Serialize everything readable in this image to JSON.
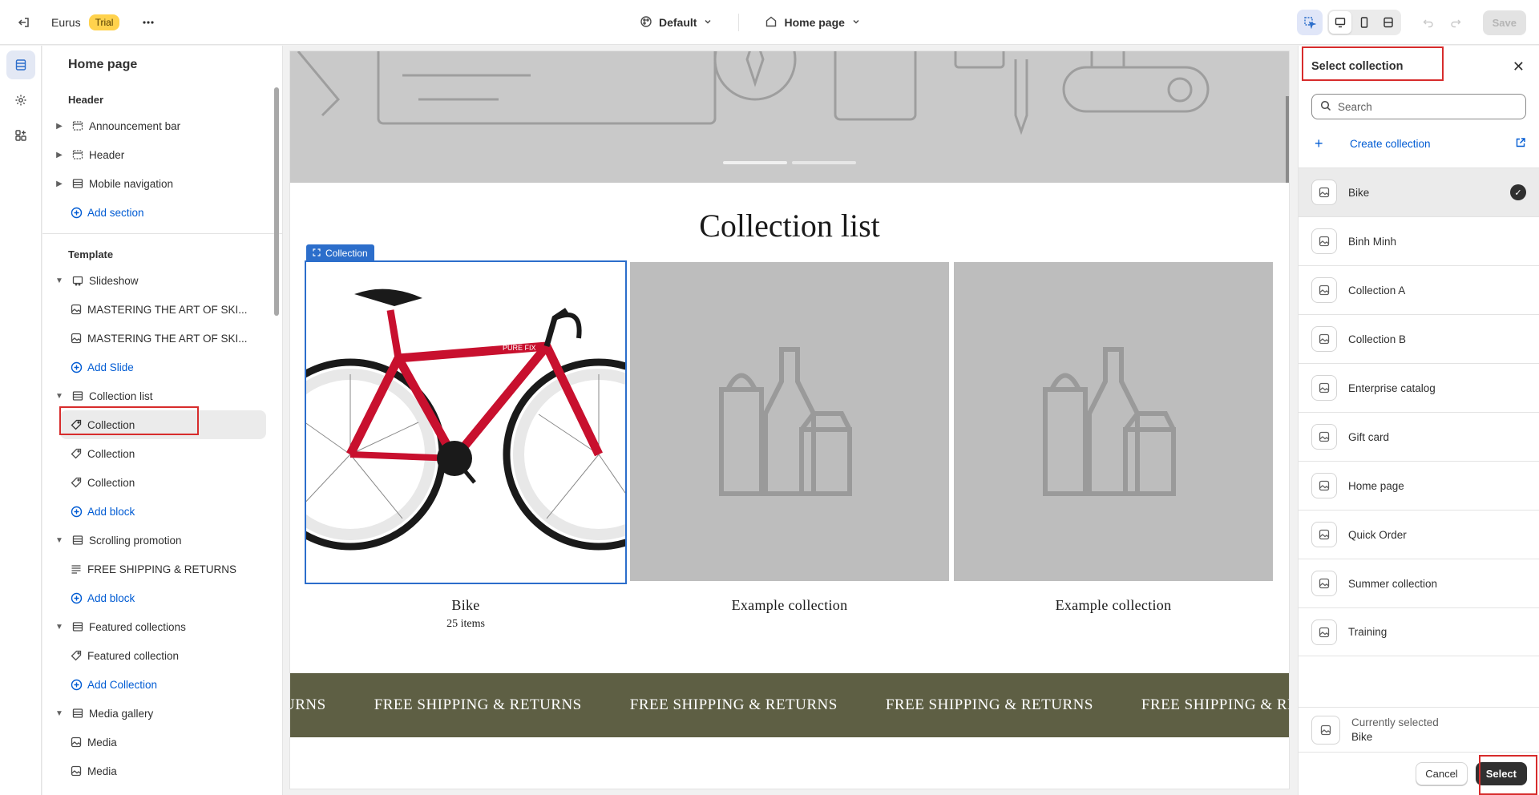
{
  "topbar": {
    "store_name": "Eurus",
    "trial_badge": "Trial",
    "theme_selector": "Default",
    "page_selector": "Home page",
    "save_label": "Save"
  },
  "sidebar": {
    "title": "Home page",
    "header_group": "Header",
    "header_items": [
      "Announcement bar",
      "Header",
      "Mobile navigation"
    ],
    "add_section": "Add section",
    "template_group": "Template",
    "slideshow": "Slideshow",
    "slides": [
      "MASTERING THE ART OF SKI...",
      "MASTERING THE ART OF SKI..."
    ],
    "add_slide": "Add Slide",
    "collection_list": "Collection list",
    "collections": [
      "Collection",
      "Collection",
      "Collection"
    ],
    "add_block": "Add block",
    "scrolling_promotion": "Scrolling promotion",
    "promo_item": "FREE SHIPPING & RETURNS",
    "add_block_2": "Add block",
    "featured_collections": "Featured collections",
    "featured_collection": "Featured collection",
    "add_collection": "Add Collection",
    "media_gallery": "Media gallery",
    "media_items": [
      "Media",
      "Media"
    ]
  },
  "preview": {
    "section_title": "Collection list",
    "tag_label": "Collection",
    "cards": [
      {
        "name": "Bike",
        "count": "25 items"
      },
      {
        "name": "Example collection",
        "count": ""
      },
      {
        "name": "Example collection",
        "count": ""
      }
    ],
    "marquee_partial": "URNS",
    "marquee_text": "FREE SHIPPING & RETURNS"
  },
  "panel": {
    "title": "Select collection",
    "search_placeholder": "Search",
    "create_label": "Create collection",
    "items": [
      "Bike",
      "Binh Minh",
      "Collection A",
      "Collection B",
      "Enterprise catalog",
      "Gift card",
      "Home page",
      "Quick Order",
      "Summer collection",
      "Training"
    ],
    "selected_item": "Bike",
    "currently_selected_label": "Currently selected",
    "currently_selected_value": "Bike",
    "cancel_label": "Cancel",
    "select_label": "Select"
  },
  "colors": {
    "accent": "#2c6ecb",
    "link": "#005bd3",
    "highlight": "#d72c2c",
    "marquee_bg": "#5e5f44",
    "trial_bg": "#ffd24d"
  }
}
